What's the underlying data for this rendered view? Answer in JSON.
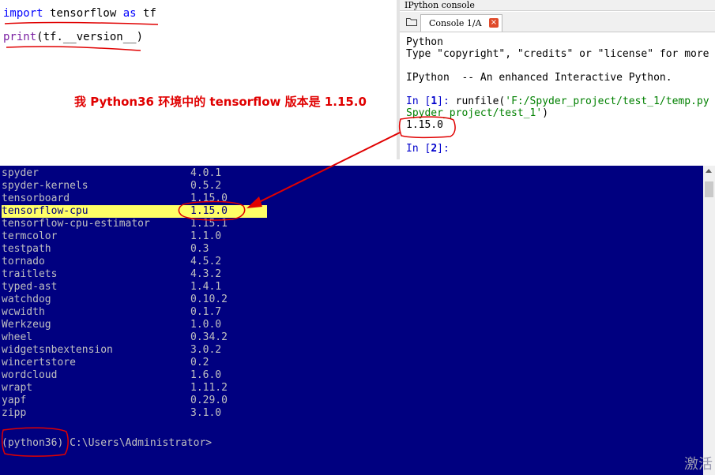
{
  "editor": {
    "line1": {
      "kw_import": "import",
      "module": " tensorflow ",
      "kw_as": "as",
      "alias": " tf"
    },
    "line2": {
      "fn": "print",
      "rest": "(tf.__version__)"
    },
    "annotation": "我 Python36 环境中的 tensorflow 版本是 1.15.0"
  },
  "console": {
    "pane_title": "IPython console",
    "tab_label": "Console 1/A",
    "close_glyph": "×",
    "lines": {
      "l1": "Python",
      "l2": "Type \"copyright\", \"credits\" or \"license\" for more",
      "l4": "IPython  -- An enhanced Interactive Python.",
      "in1_prefix": "In [",
      "in1_num": "1",
      "in1_suffix": "]: ",
      "in1_call": "runfile(",
      "in1_arg": "'F:/Spyder_project/test_1/temp.py",
      "in1_cont": "Spyder_project/test_1'",
      "in1_close": ")",
      "out": "1.15.0",
      "in2_prefix": "In [",
      "in2_num": "2",
      "in2_suffix": "]:"
    }
  },
  "terminal": {
    "packages": [
      {
        "name": "spyder",
        "version": "4.0.1"
      },
      {
        "name": "spyder-kernels",
        "version": "0.5.2"
      },
      {
        "name": "tensorboard",
        "version": "1.15.0"
      },
      {
        "name": "tensorflow-cpu",
        "version": "1.15.0",
        "highlight": true
      },
      {
        "name": "tensorflow-cpu-estimator",
        "version": "1.15.1"
      },
      {
        "name": "termcolor",
        "version": "1.1.0"
      },
      {
        "name": "testpath",
        "version": "0.3"
      },
      {
        "name": "tornado",
        "version": "4.5.2"
      },
      {
        "name": "traitlets",
        "version": "4.3.2"
      },
      {
        "name": "typed-ast",
        "version": "1.4.1"
      },
      {
        "name": "watchdog",
        "version": "0.10.2"
      },
      {
        "name": "wcwidth",
        "version": "0.1.7"
      },
      {
        "name": "Werkzeug",
        "version": "1.0.0"
      },
      {
        "name": "wheel",
        "version": "0.34.2"
      },
      {
        "name": "widgetsnbextension",
        "version": "3.0.2"
      },
      {
        "name": "wincertstore",
        "version": "0.2"
      },
      {
        "name": "wordcloud",
        "version": "1.6.0"
      },
      {
        "name": "wrapt",
        "version": "1.11.2"
      },
      {
        "name": "yapf",
        "version": "0.29.0"
      },
      {
        "name": "zipp",
        "version": "3.1.0"
      }
    ],
    "prompt": "(python36) C:\\Users\\Administrator>"
  },
  "watermark": "激活",
  "colors": {
    "terminal_bg": "#000080",
    "terminal_text": "#c0c0c0",
    "highlight_row": "#ffff66",
    "annotation_red": "#e00000",
    "keyword_blue": "#0000ff"
  }
}
